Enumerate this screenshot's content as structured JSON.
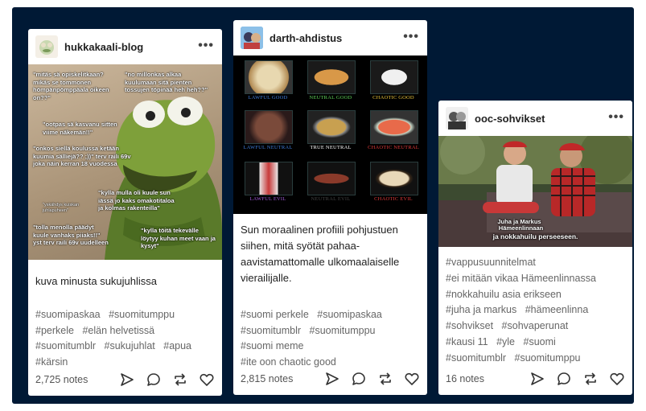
{
  "posts": [
    {
      "blog": "hukkakaali-blog",
      "meme_text": [
        "\"mitäs sä opiskelitkaan? mikäs se tommonen hömpänpömppäala oikeen on??\"",
        "\"no millonkas alkaa kuulumaan sitä pienten tossujen töpinää heh heh??\"",
        "\"ootpas sä kasvanu sitten viime näkemän!!\"",
        "\"onkos siellä koulussa ketään kuumia sälliejä?? ;))\" terv raili 69v joka näin kerran 18 vuodessa",
        "\"kylla mulla oli kuule sun iässä jo kaks omakotitaloa ja kolmas rakenteilla\"",
        "\"yskähdys kuiskan juhlapuheen\"",
        "\"tolla menolla päädyt kuule vanhaks piiaks!!\" yst terv raili 69v uudelleen",
        "\"kylla töitä tekevälle löytyy kuhan meet vaan ja kysyt\""
      ],
      "caption": "kuva minusta sukujuhlissa",
      "tags": [
        "#suomipaskaa",
        "#suomitumppu",
        "#perkele",
        "#elän helvetissä",
        "#suomitumblr",
        "#sukujuhlat",
        "#apua",
        "#kärsin"
      ],
      "notes": "2,725 notes"
    },
    {
      "blog": "darth-ahdistus",
      "grid": [
        {
          "label": "LAWFUL GOOD",
          "color": "#3d7bd9"
        },
        {
          "label": "NEUTRAL GOOD",
          "color": "#5fd35a"
        },
        {
          "label": "CHAOTIC GOOD",
          "color": "#e6c23a"
        },
        {
          "label": "LAWFUL NEUTRAL",
          "color": "#3d7bd9"
        },
        {
          "label": "TRUE NEUTRAL",
          "color": "#ffffff"
        },
        {
          "label": "CHAOTIC NEUTRAL",
          "color": "#e03a3a"
        },
        {
          "label": "LAWFUL EVIL",
          "color": "#a25ad9"
        },
        {
          "label": "NEUTRAL EVIL",
          "color": "#444444"
        },
        {
          "label": "CHAOTIC EVIL",
          "color": "#e03a3a"
        }
      ],
      "caption": "Sun moraalinen profiili pohjustuen siihen, mitä syötät pahaa-aavistamattomalle ulkomaalaiselle vierailijalle.",
      "tags": [
        "#suomi perkele",
        "#suomipaskaa",
        "#suomitumblr",
        "#suomitumppu",
        "#suomi meme",
        "#ite oon chaotic good"
      ],
      "notes": "2,815 notes"
    },
    {
      "blog": "ooc-sohvikset",
      "subtitle": [
        "Juha ja Markus",
        "Hämeenlinnaan",
        "ja nokkahuilu perseeseen."
      ],
      "tags": [
        "#vappusuunnitelmat",
        "#ei mitään vikaa Hämeenlinnassa",
        "#nokkahuilu asia erikseen",
        "#juha ja markus",
        "#hämeenlinna",
        "#sohvikset",
        "#sohvaperunat",
        "#kausi 11",
        "#yle",
        "#suomi",
        "#suomitumblr",
        "#suomitumppu"
      ],
      "notes": "16 notes"
    }
  ],
  "colors": {
    "background": "#001935",
    "card": "#ffffff",
    "tag": "#666666"
  },
  "icons": [
    "more-icon",
    "share-icon",
    "reply-icon",
    "reblog-icon",
    "like-icon"
  ]
}
